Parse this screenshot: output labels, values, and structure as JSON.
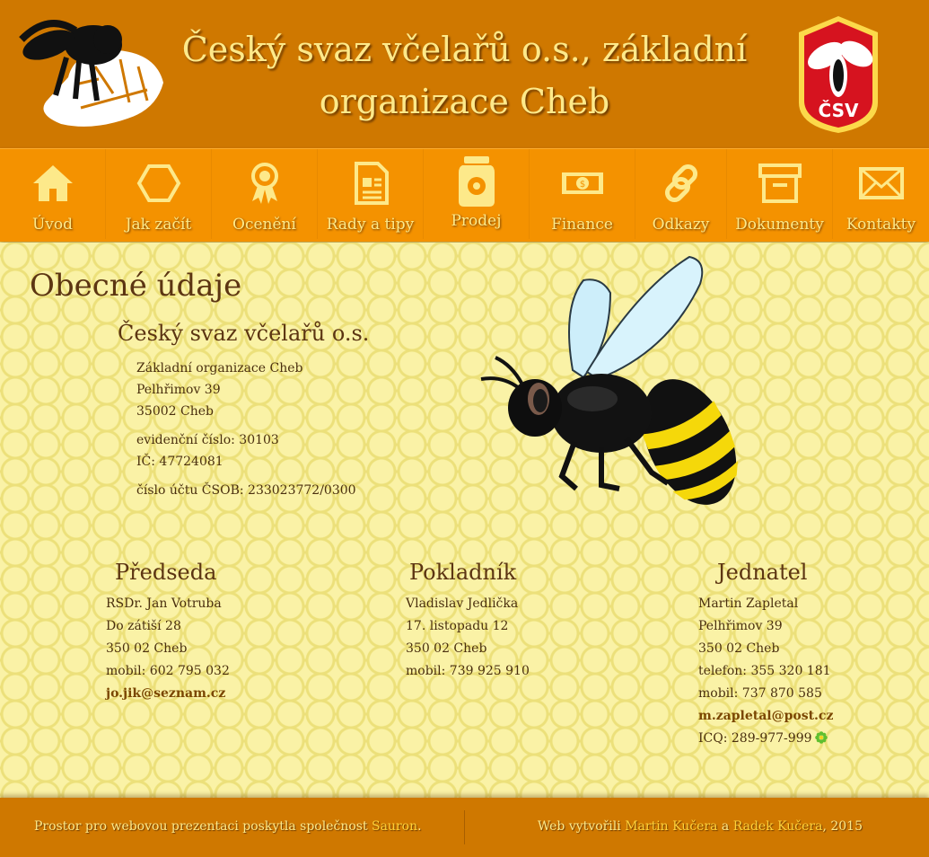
{
  "header": {
    "title_line1": "Český svaz včelařů o.s., základní",
    "title_line2": "organizace Cheb",
    "emblem_text": "ČSV"
  },
  "nav": {
    "items": [
      {
        "label": "Úvod",
        "icon": "home-icon"
      },
      {
        "label": "Jak začít",
        "icon": "hexagon-icon"
      },
      {
        "label": "Ocenění",
        "icon": "award-icon"
      },
      {
        "label": "Rady a tipy",
        "icon": "document-icon"
      },
      {
        "label": "Prodej",
        "icon": "honey-jar-icon"
      },
      {
        "label": "Finance",
        "icon": "banknote-icon"
      },
      {
        "label": "Odkazy",
        "icon": "link-icon"
      },
      {
        "label": "Dokumenty",
        "icon": "archive-box-icon"
      },
      {
        "label": "Kontakty",
        "icon": "envelope-icon"
      }
    ]
  },
  "main": {
    "heading": "Obecné údaje",
    "org_name": "Český svaz včelařů o.s.",
    "address": [
      "Základní organizace Cheb",
      "Pelhřimov 39",
      "35002 Cheb"
    ],
    "registration": [
      "evidenční číslo: 30103",
      "IČ: 47724081"
    ],
    "account": "číslo účtu ČSOB: 233023772/0300"
  },
  "contacts": {
    "chairman": {
      "title": "Předseda",
      "name": "RSDr. Jan Votruba",
      "street": "Do zátiší 28",
      "city": "350 02 Cheb",
      "mobile": "mobil: 602 795 032",
      "email": "jo.jik@seznam.cz"
    },
    "treasurer": {
      "title": "Pokladník",
      "name": "Vladislav Jedlička",
      "street": "17. listopadu 12",
      "city": "350 02 Cheb",
      "mobile": "mobil: 739 925 910"
    },
    "agent": {
      "title": "Jednatel",
      "name": "Martin Zapletal",
      "street": "Pelhřimov 39",
      "city": "350 02 Cheb",
      "phone": "telefon: 355 320 181",
      "mobile": "mobil: 737 870 585",
      "email": "m.zapletal@post.cz",
      "icq": "ICQ: 289-977-999"
    }
  },
  "footer": {
    "left_text": "Prostor pro webovou prezentaci poskytla společnost ",
    "left_link": "Sauron",
    "left_end": ".",
    "right_text": "Web vytvořili ",
    "right_author1": "Martin Kučera",
    "right_and": " a ",
    "right_author2": "Radek Kučera",
    "right_year": ", 2015"
  },
  "colors": {
    "header_bg": "#cf7800",
    "nav_bg": "#f49200",
    "title_text": "#fde98a",
    "heading_text": "#5c3512",
    "page_bg": "#f6ea8a"
  }
}
